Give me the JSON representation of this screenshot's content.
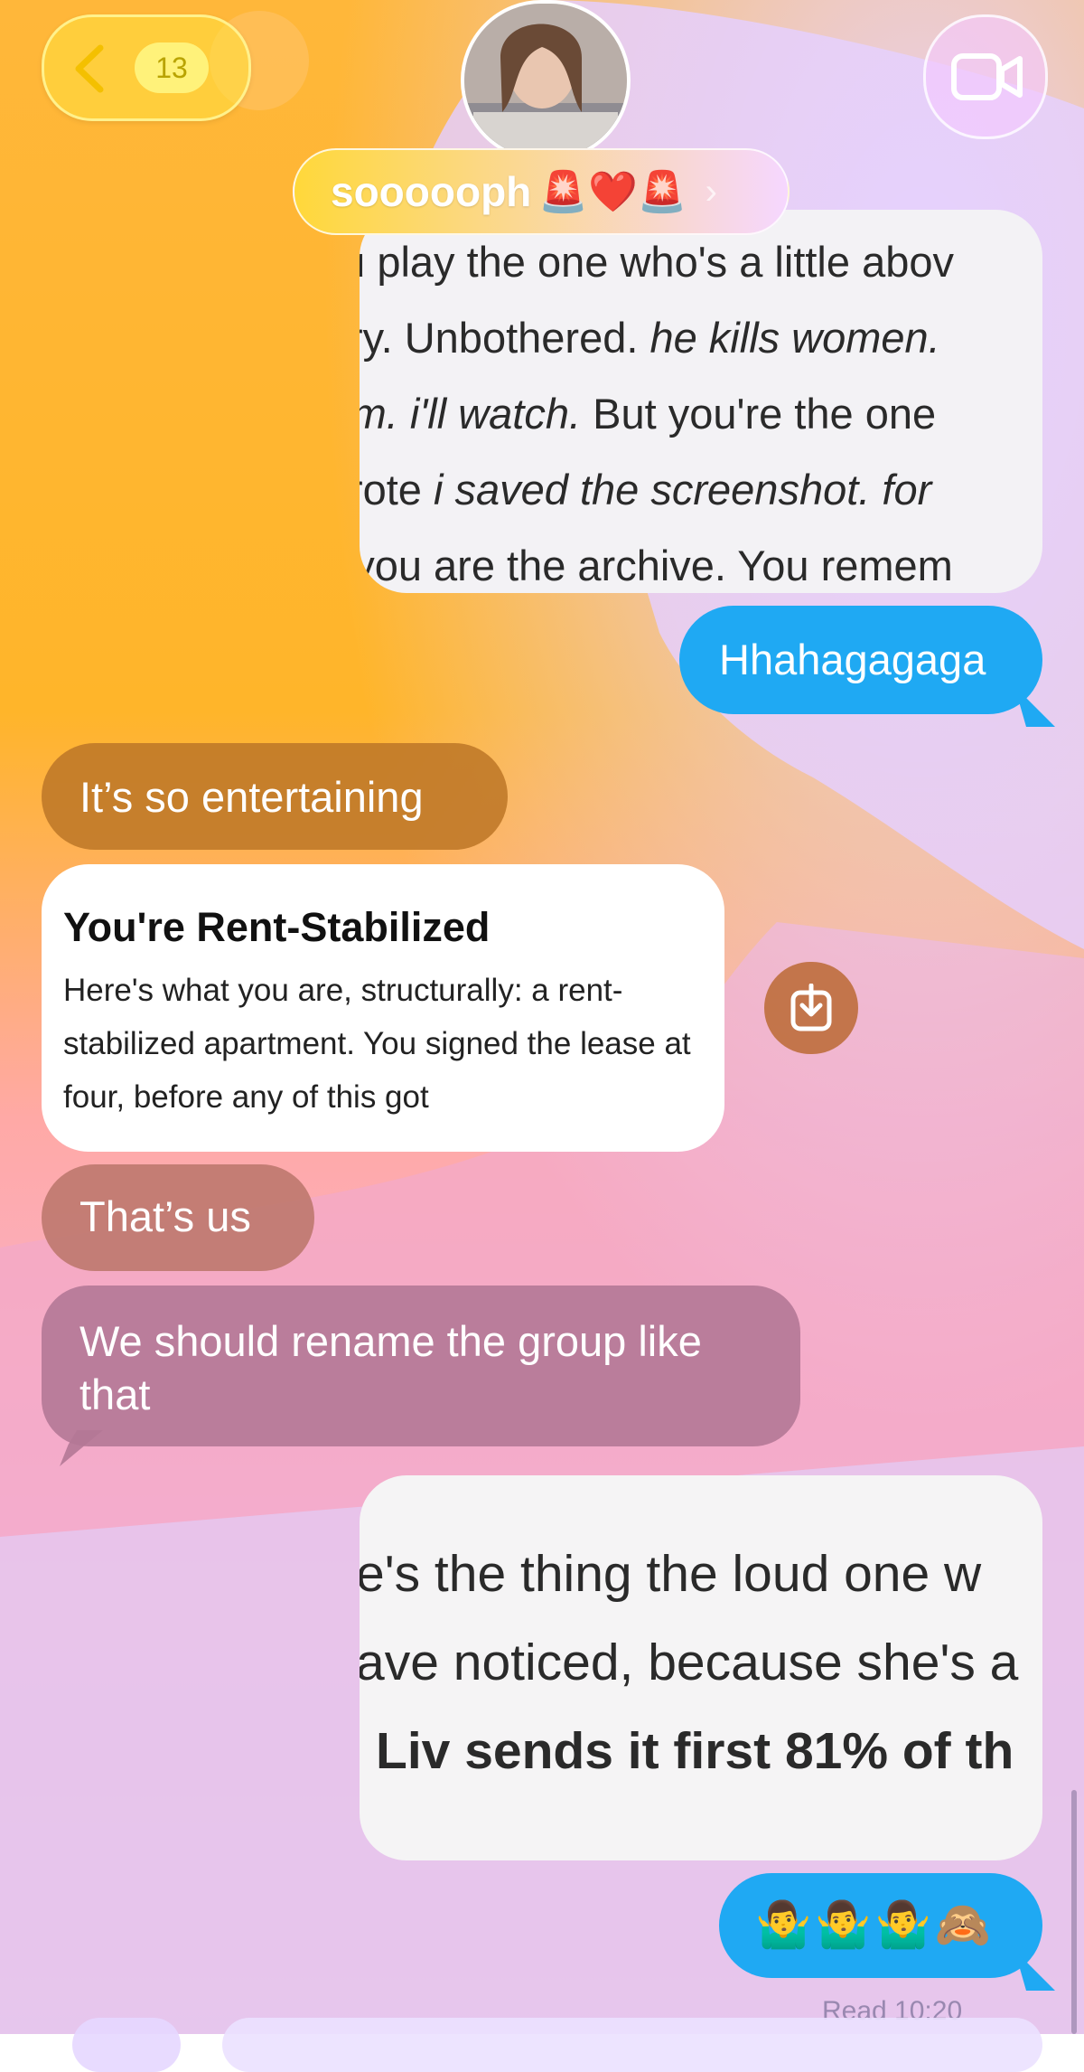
{
  "header": {
    "unread_count": "13",
    "contact_name": "soooooph",
    "name_emojis": "🚨❤️🚨",
    "name_chevron": "›"
  },
  "messages": {
    "card_top_lines": [
      {
        "pre": "ou play the one who's a little abov",
        "it": ""
      },
      {
        "pre": "Dry. Unbothered. ",
        "it": "he kills women."
      },
      {
        "pre": "",
        "it": " him. i'll watch.",
        "post": " But you're the one"
      },
      {
        "pre": "wrote ",
        "it": "i saved the screenshot. for"
      },
      {
        "pre": "– you are the archive. You remem",
        "it": ""
      }
    ],
    "out_1": "Hhahagagaga",
    "in_1": "It’s so entertaining",
    "card_rent": {
      "title": "You're Rent-Stabilized",
      "body": "Here's what you are, structurally: a rent-stabilized apartment. You signed the lease at four, before any of this got"
    },
    "in_2": "That’s us",
    "in_3": "We should rename the group like that",
    "card_bottom_lines": [
      "e's the thing the loud one w",
      "ave noticed, because she's a",
      "Liv sends it first 81% of th"
    ],
    "out_2": "🤷‍♂️🤷‍♂️🤷‍♂️🙈",
    "read_receipt": "Read 10:20"
  },
  "icons": [
    "back-chevron-icon",
    "video-camera-icon",
    "download-icon"
  ],
  "colors": {
    "bubble_blue": "#1fa9f3",
    "bg_orange": "#ffb52a",
    "bg_pink": "#ffa6b8",
    "bg_lavender": "#e6d2ff"
  }
}
